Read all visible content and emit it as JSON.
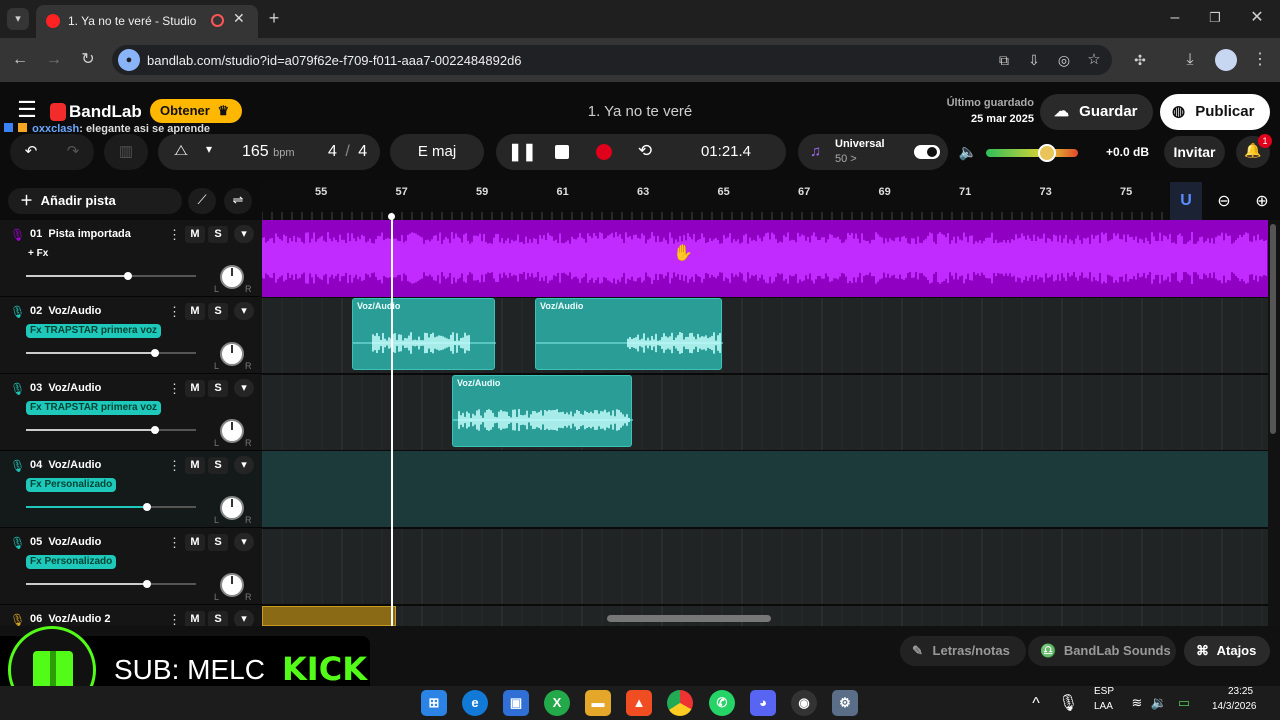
{
  "browser": {
    "tab_title": "1. Ya no te veré - Studio",
    "url": "bandlab.com/studio?id=a079f62e-f709-f011-aaa7-0022484892d6"
  },
  "header": {
    "logo": "BandLab",
    "obtener": "Obtener",
    "project_title": "1. Ya no te veré",
    "saved_label": "Último guardado",
    "saved_date": "25 mar 2025",
    "guardar": "Guardar",
    "publicar": "Publicar",
    "chat_user": "oxxclash",
    "chat_msg": ": elegante asi se aprende"
  },
  "transport": {
    "bpm": "165",
    "bpm_unit": "bpm",
    "sig_num": "4",
    "sig_sep": "/",
    "sig_den": "4",
    "key": "E maj",
    "time": "01:21.4",
    "instrument": "Universal",
    "instrument_sub": "50 >",
    "volume": "+0.0 dB",
    "invitar": "Invitar",
    "notif_count": "1"
  },
  "tracks_header": {
    "add": "Añadir pista"
  },
  "ruler": [
    "55",
    "57",
    "59",
    "61",
    "63",
    "65",
    "67",
    "69",
    "71",
    "73",
    "75"
  ],
  "tracks": [
    {
      "num": "01",
      "name": "Pista importada",
      "fx": "+ Fx",
      "m": "M",
      "s": "S",
      "L": "L",
      "R": "R"
    },
    {
      "num": "02",
      "name": "Voz/Audio",
      "fx": "Fx TRAPSTAR primera voz",
      "m": "M",
      "s": "S",
      "L": "L",
      "R": "R"
    },
    {
      "num": "03",
      "name": "Voz/Audio",
      "fx": "Fx TRAPSTAR primera voz",
      "m": "M",
      "s": "S",
      "L": "L",
      "R": "R"
    },
    {
      "num": "04",
      "name": "Voz/Audio",
      "fx": "Fx Personalizado",
      "m": "M",
      "s": "S",
      "L": "L",
      "R": "R"
    },
    {
      "num": "05",
      "name": "Voz/Audio",
      "fx": "Fx Personalizado",
      "m": "M",
      "s": "S",
      "L": "L",
      "R": "R"
    },
    {
      "num": "06",
      "name": "Voz/Audio 2",
      "m": "M",
      "s": "S"
    }
  ],
  "clips": {
    "c1": "Voz/Audio",
    "c2": "Voz/Audio",
    "c3": "Voz/Audio"
  },
  "bottom": {
    "letras": "Letras/notas",
    "sounds": "BandLab Sounds",
    "atajos": "Atajos"
  },
  "overlay": {
    "sub": "SUB: MELC",
    "kick": "KICK"
  },
  "taskbar": {
    "lang1": "ESP",
    "lang2": "LAA",
    "time": "23:25",
    "date": "14/3/2026"
  },
  "colors": {
    "accent": "#a200d6",
    "teal": "#1ec9bb",
    "record": "#e0001b",
    "kick": "#53fc18"
  }
}
